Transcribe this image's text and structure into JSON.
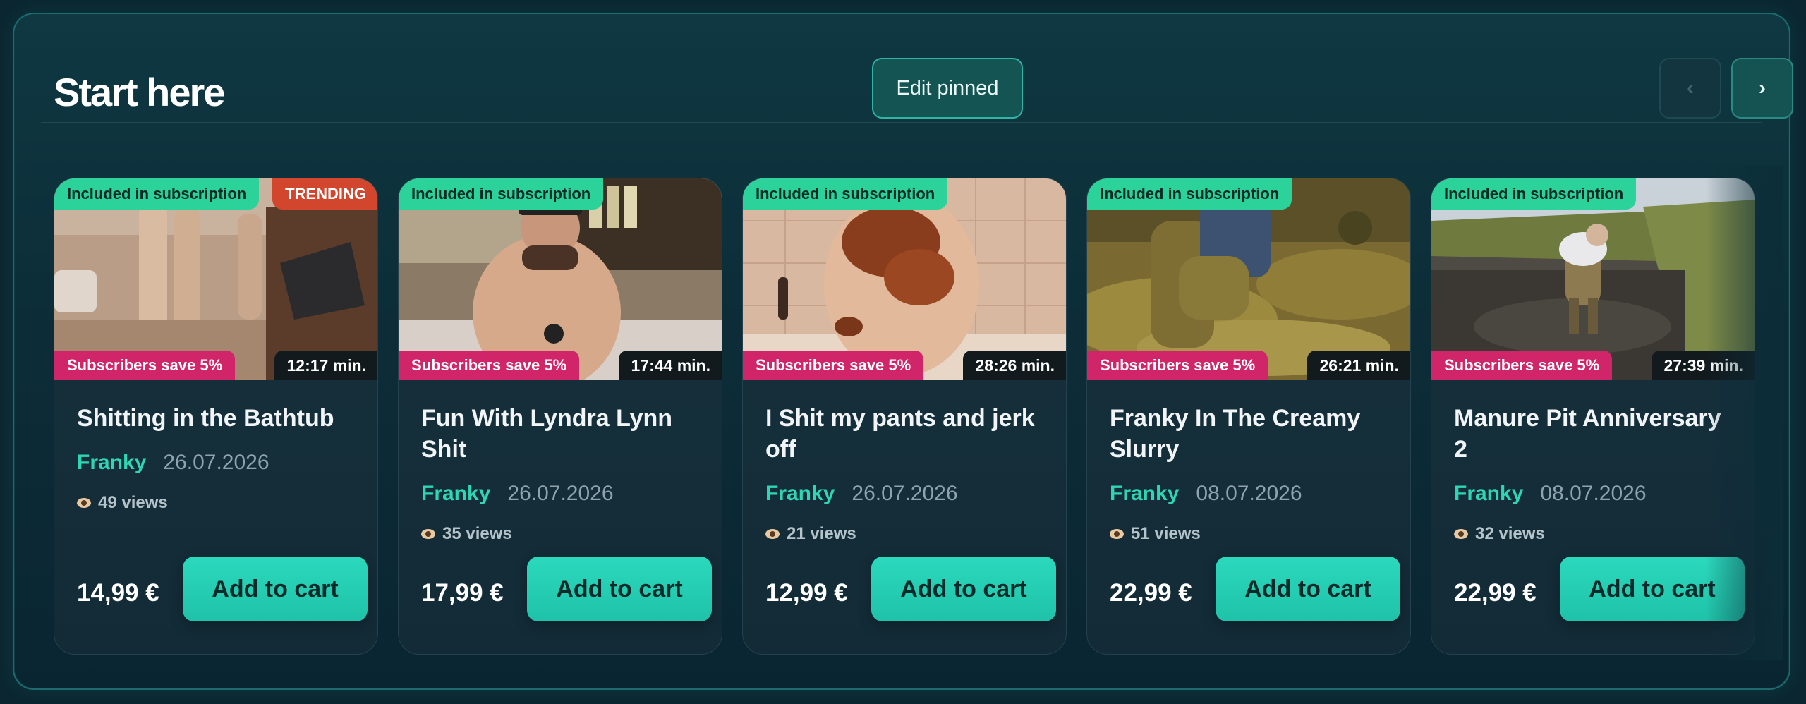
{
  "section": {
    "title": "Start here",
    "edit_label": "Edit pinned",
    "prev_label": "‹",
    "next_label": "›"
  },
  "cards": [
    {
      "badge_subscription": "Included in subscription",
      "badge_trending": "TRENDING",
      "badge_save": "Subscribers save 5%",
      "duration": "12:17 min.",
      "title": "Shitting in the Bathtub",
      "author": "Franky",
      "date": "26.07.2026",
      "views": "49 views",
      "price": "14,99 €",
      "cart_label": "Add to cart"
    },
    {
      "badge_subscription": "Included in subscription",
      "badge_save": "Subscribers save 5%",
      "duration": "17:44 min.",
      "title": "Fun With Lyndra Lynn Shit",
      "author": "Franky",
      "date": "26.07.2026",
      "views": "35 views",
      "price": "17,99 €",
      "cart_label": "Add to cart"
    },
    {
      "badge_subscription": "Included in subscription",
      "badge_save": "Subscribers save 5%",
      "duration": "28:26 min.",
      "title": "I Shit my pants and jerk off",
      "author": "Franky",
      "date": "26.07.2026",
      "views": "21 views",
      "price": "12,99 €",
      "cart_label": "Add to cart"
    },
    {
      "badge_subscription": "Included in subscription",
      "badge_save": "Subscribers save 5%",
      "duration": "26:21 min.",
      "title": "Franky In The Creamy Slurry",
      "author": "Franky",
      "date": "08.07.2026",
      "views": "51 views",
      "price": "22,99 €",
      "cart_label": "Add to cart"
    },
    {
      "badge_subscription": "Included in subscription",
      "badge_save": "Subscribers save 5%",
      "duration": "27:39 min.",
      "title": "Manure Pit Anniversary 2",
      "author": "Franky",
      "date": "08.07.2026",
      "views": "32 views",
      "price": "22,99 €",
      "cart_label": "Add to cart"
    }
  ],
  "colors": {
    "accent": "#2bd9bd",
    "subscription_badge": "#2bd39b",
    "trending_badge": "#d2462e",
    "save_badge": "#d1256a",
    "author": "#2fd6b4"
  },
  "icons": {
    "views": "eye-icon",
    "prev": "chevron-left-icon",
    "next": "chevron-right-icon"
  }
}
